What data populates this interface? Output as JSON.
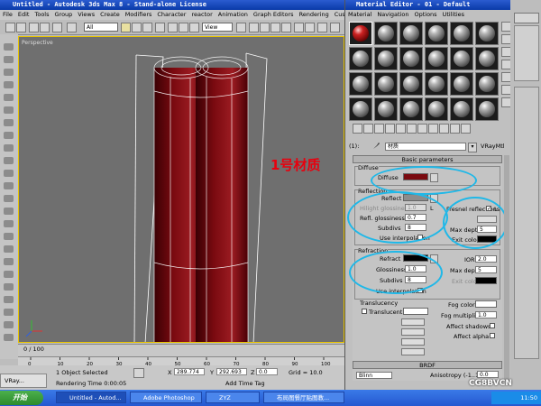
{
  "max": {
    "title": "Untitled - Autodesk 3ds Max 8 - Stand-alone License",
    "menu": [
      "File",
      "Edit",
      "Tools",
      "Group",
      "Views",
      "Create",
      "Modifiers",
      "Character",
      "reactor",
      "Animation",
      "Graph Editors",
      "Rendering",
      "Customize",
      "M"
    ],
    "toolbar_select_value": "All",
    "view_select_value": "View",
    "viewport_label": "Perspective",
    "frame_counter": "0 / 100",
    "ruler_ticks": [
      "0",
      "10",
      "20",
      "30",
      "40",
      "50",
      "60",
      "70",
      "80",
      "90",
      "100"
    ],
    "status_selected": "1 Object Selected",
    "status_render_time": "Rendering Time 0:00:05",
    "coord_x_label": "X",
    "coord_x_value": "289.774",
    "coord_y_label": "Y",
    "coord_y_value": "292.693",
    "coord_z_label": "Z",
    "coord_z_value": "0.0",
    "grid_text": "Grid = 10.0",
    "add_time_tag": "Add Time Tag"
  },
  "overlay_text": "1号材质",
  "material_editor": {
    "title": "Material Editor - 01 - Default",
    "menu": [
      "Material",
      "Navigation",
      "Options",
      "Utilities"
    ],
    "material_name_prefix": "(1):",
    "material_name": "材质",
    "material_type": "VRayMtl",
    "basic_parameters_header": "Basic parameters",
    "diffuse_group_label": "Diffuse",
    "diffuse_label": "Diffuse",
    "diffuse_color": "#7a0a10",
    "reflection_group_label": "Reflection",
    "reflect_label": "Reflect",
    "reflect_color": "#8c8c8c",
    "hilight_gloss_label": "Hilight glossiness",
    "hilight_gloss_value": "1.0",
    "refl_gloss_label": "Refl. glossiness",
    "refl_gloss_value": "0.7",
    "subdivs_label": "Subdivs",
    "subdivs_value": "8",
    "use_interp_label": "Use interpolation",
    "fresnel_label": "Fresnel reflections",
    "fresnel_checked": "✓",
    "l_label": "L",
    "max_depth_label": "Max depth",
    "max_depth_value": "5",
    "exit_color_label": "Exit color",
    "exit_color": "#000000",
    "refraction_group_label": "Refraction",
    "refract_label": "Refract",
    "refract_color": "#000000",
    "ior_label": "IOR",
    "ior_value": "2.0",
    "refr_gloss_label": "Glossiness",
    "refr_gloss_value": "1.0",
    "refr_max_depth_label": "Max depth",
    "refr_max_depth_value": "5",
    "refr_subdivs_label": "Subdivs",
    "refr_subdivs_value": "8",
    "refr_exit_color_label": "Exit color",
    "refr_use_interp_label": "Use interpolation",
    "fog_color_label": "Fog color",
    "fog_color": "#ffffff",
    "fog_mult_label": "Fog multiplier",
    "fog_mult_value": "1.0",
    "affect_shadows_label": "Affect shadows",
    "affect_alpha_label": "Affect alpha",
    "translucency_label": "Translucency",
    "translucent_label": "Translucent",
    "translucent_color": "#ffffff",
    "brdf_header": "BRDF",
    "brdf_type": "Blinn",
    "anisotropy_label": "Anisotropy (-1..1)",
    "anisotropy_value": "0.0",
    "annotation_color": "#1fb8e8"
  },
  "taskbar": {
    "start_label": "开始",
    "tasks": [
      "Untitled - Autod...",
      "Adobe Photoshop",
      "ZYZ",
      "布局图餐厅贴图教..."
    ],
    "clock": "11:50",
    "vray_window": "VRay..."
  },
  "watermark": "CG8BVCN"
}
